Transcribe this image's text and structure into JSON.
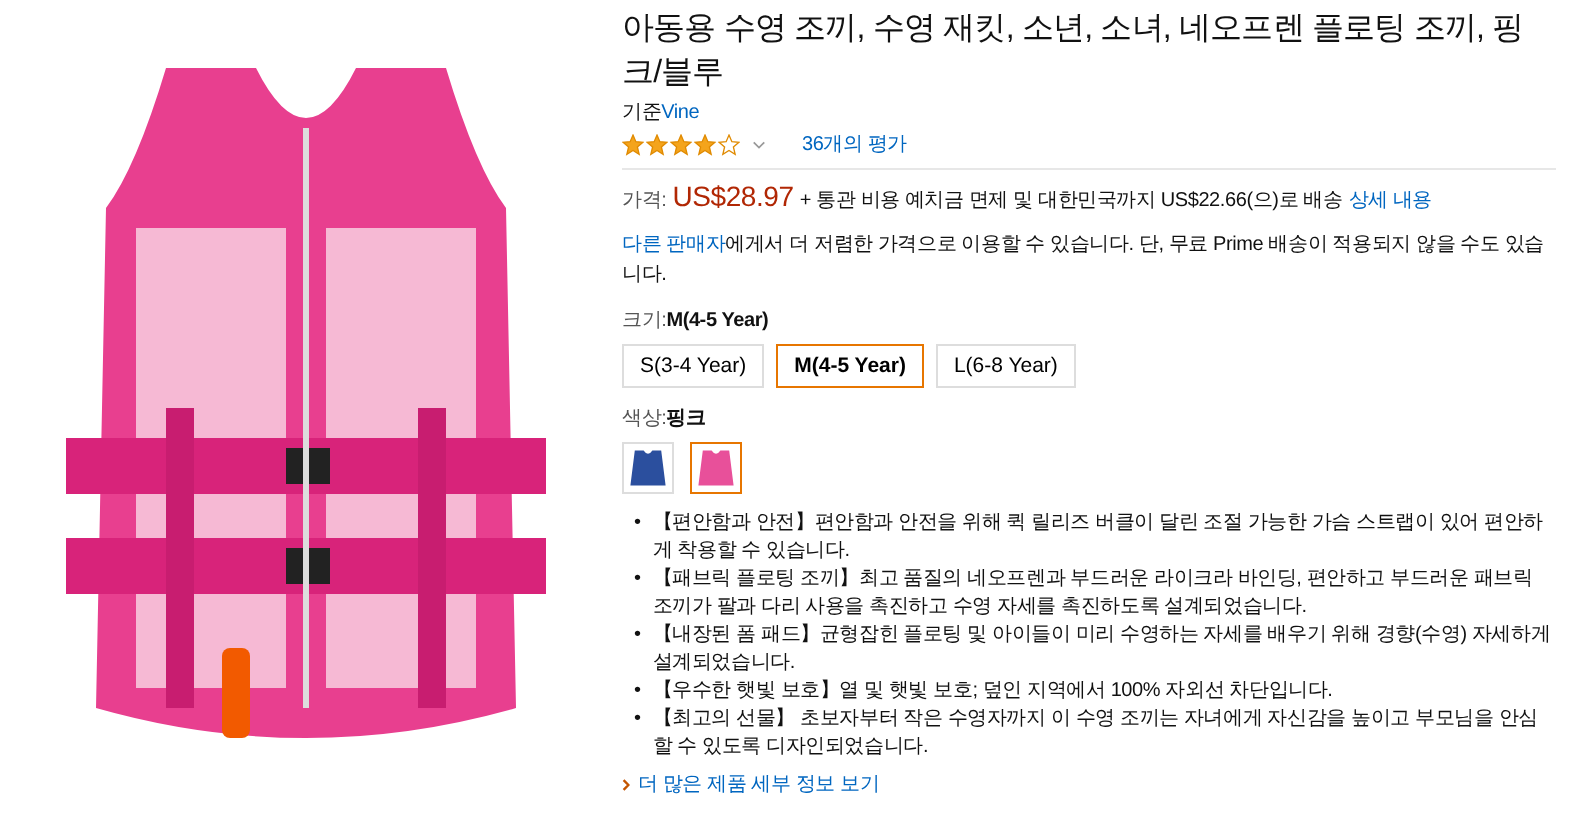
{
  "product": {
    "title": "아동용 수영 조끼, 수영 재킷, 소년, 소녀, 네오프렌 플로팅 조끼, 핑크/블루",
    "byline_prefix": "기준",
    "brand": "Vine",
    "stars": 4,
    "rating_link": "36개의 평가"
  },
  "price": {
    "label": "가격:",
    "amount": "US$28.97",
    "shipping": "+ 통관 비용 예치금 면제 및 대한민국까지 US$22.66(으)로 배송",
    "details_link": "상세 내용"
  },
  "other_sellers": {
    "link": "다른 판매자",
    "text": "에게서 더 저렴한 가격으로 이용할 수 있습니다. 단, 무료 Prime 배송이 적용되지 않을 수도 있습니다."
  },
  "size": {
    "label": "크기:",
    "value": "M(4-5 Year)",
    "options": [
      {
        "label": "S(3-4 Year)",
        "selected": false
      },
      {
        "label": "M(4-5 Year)",
        "selected": true
      },
      {
        "label": "L(6-8 Year)",
        "selected": false
      }
    ]
  },
  "color": {
    "label": "색상:",
    "value": "핑크",
    "swatches": [
      {
        "color": "#2b4f9e",
        "selected": false
      },
      {
        "color": "#e8509a",
        "selected": true
      }
    ]
  },
  "bullet_marker": "•",
  "bullets": [
    "【편안함과 안전】편안함과 안전을 위해 퀵 릴리즈 버클이 달린 조절 가능한 가슴 스트랩이 있어 편안하게 착용할 수 있습니다.",
    "【패브릭 플로팅 조끼】최고 품질의 네오프렌과 부드러운 라이크라 바인딩, 편안하고 부드러운 패브릭 조끼가 팔과 다리 사용을 촉진하고 수영 자세를 촉진하도록 설계되었습니다.",
    "【내장된 폼 패드】균형잡힌 플로팅 및 아이들이 미리 수영하는 자세를 배우기 위해 경향(수영) 자세하게 설계되었습니다.",
    "【우수한 햇빛 보호】열 및 햇빛 보호; 덮인 지역에서 100% 자외선 차단입니다.",
    "【최고의 선물】 초보자부터 작은 수영자까지 이 수영 조끼는 자녀에게 자신감을 높이고 부모님을 안심할 수 있도록 디자인되었습니다."
  ],
  "more_link": "더 많은 제품 세부 정보 보기"
}
